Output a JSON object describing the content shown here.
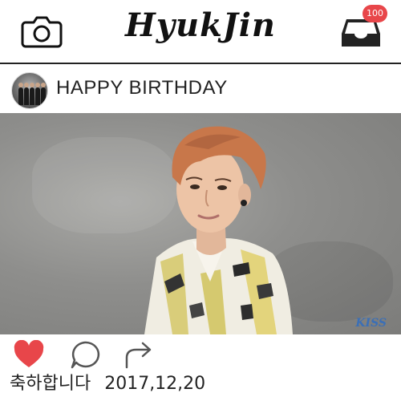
{
  "app": {
    "brand": "HyukJin",
    "notification_count": "100"
  },
  "post": {
    "title": "HAPPY BIRTHDAY",
    "caption_text": "축하합니다",
    "caption_date": "2017,12,20",
    "watermark": "KISS",
    "liked": true
  },
  "icons": {
    "camera": "camera-icon",
    "inbox": "inbox-icon",
    "like": "heart-icon",
    "comment": "comment-icon",
    "share": "share-icon"
  },
  "colors": {
    "like_red": "#e8464a",
    "badge_red": "#e8464a",
    "text": "#222222"
  }
}
